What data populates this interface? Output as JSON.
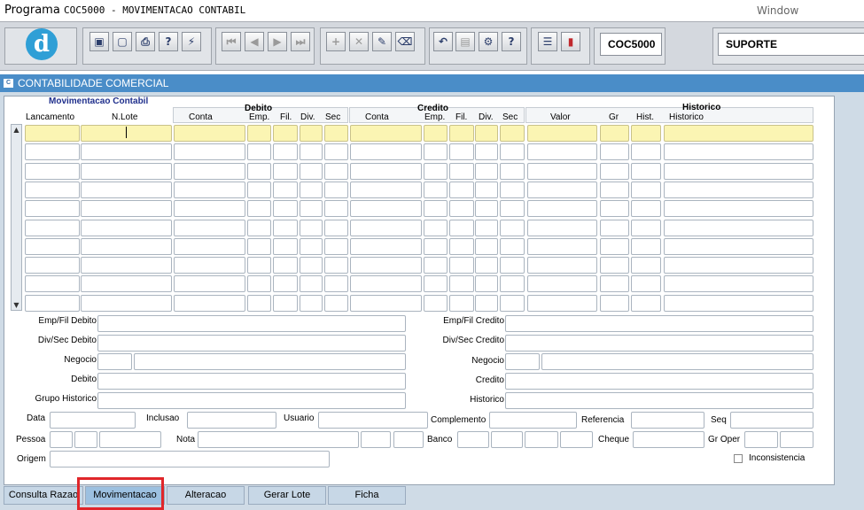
{
  "menu": {
    "programa": "Programa",
    "title": "COC5000 - MOVIMENTACAO CONTABIL",
    "window": "Window"
  },
  "toolbar": {
    "icons": [
      "save-icon",
      "window-icon",
      "print-icon",
      "help-query-icon",
      "wizard-icon",
      "first-record-icon",
      "prev-record-icon",
      "next-record-icon",
      "last-record-icon",
      "add-record-icon",
      "delete-record-icon",
      "edit-record-icon",
      "clear-icon",
      "undo-icon",
      "clipboard-icon",
      "lookup-icon",
      "help-icon",
      "menu-icon",
      "exit-icon"
    ],
    "logo": "d",
    "form_code": "COC5000",
    "user": "SUPORTE"
  },
  "window": {
    "title": "CONTABILIDADE COMERCIAL"
  },
  "block": {
    "title": "Movimentacao Contabil",
    "group_debito": "Debito",
    "group_credito": "Credito",
    "group_historico": "Historico",
    "columns": {
      "lancamento": "Lancamento",
      "nlote": "N.Lote",
      "deb_conta": "Conta",
      "deb_emp": "Emp.",
      "deb_fil": "Fil.",
      "deb_div": "Div.",
      "deb_sec": "Sec",
      "cred_conta": "Conta",
      "cred_emp": "Emp.",
      "cred_fil": "Fil.",
      "cred_div": "Div.",
      "cred_sec": "Sec",
      "valor": "Valor",
      "gr": "Gr",
      "hist": "Hist.",
      "historico": "Historico"
    }
  },
  "detail": {
    "emp_fil_debito": "Emp/Fil Debito",
    "div_sec_debito": "Div/Sec Debito",
    "negocio_left": "Negocio",
    "debito": "Debito",
    "grupo_historico": "Grupo Historico",
    "emp_fil_credito": "Emp/Fil Credito",
    "div_sec_credito": "Div/Sec Credito",
    "negocio_right": "Negocio",
    "credito": "Credito",
    "historico": "Historico",
    "data": "Data",
    "inclusao": "Inclusao",
    "usuario": "Usuario",
    "complemento": "Complemento",
    "referencia": "Referencia",
    "seq": "Seq",
    "pessoa": "Pessoa",
    "nota": "Nota",
    "banco": "Banco",
    "cheque": "Cheque",
    "gr_oper": "Gr Oper",
    "origem": "Origem",
    "inconsistencia": "Inconsistencia"
  },
  "tabs": [
    "Consulta Razao",
    "Movimentacao",
    "Alteracao",
    "Gerar Lote",
    "Ficha"
  ],
  "active_tab": "Movimentacao"
}
